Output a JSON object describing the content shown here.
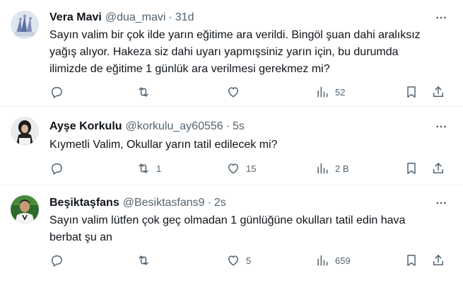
{
  "tweets": [
    {
      "name": "Vera Mavi",
      "handle": "@dua_mavi",
      "separator": "·",
      "time": "31d",
      "text_lines": [
        "Sayın valim bir çok ilde yarın eğitime ara verildi. Bingöl şuan dahi aralıksız",
        "yağış alıyor. Hakeza siz dahi uyarı yapmışsiniz yarın için, bu durumda",
        "ilimizde de eğitime 1 günlük ara verilmesi gerekmez mi?"
      ],
      "replies": "",
      "retweets": "",
      "likes": "",
      "views": "52",
      "avatar_colors": [
        "#dfe6ef",
        "#5a6fa3"
      ]
    },
    {
      "name": "Ayşe Korkulu",
      "handle": "@korkulu_ay60556",
      "separator": "·",
      "time": "5s",
      "text_lines": [
        "Kıymetli Valim, Okullar yarın tatil edilecek mi?"
      ],
      "replies": "",
      "retweets": "1",
      "likes": "15",
      "views": "2 B",
      "avatar_colors": [
        "#e9ecef",
        "#1a1a1a"
      ]
    },
    {
      "name": "Beşiktaşfans",
      "handle": "@Besiktasfans9",
      "separator": "·",
      "time": "2s",
      "text_lines": [
        "Sayın valim lütfen çok geç olmadan 1 günlüğüne okulları tatil edin hava",
        "berbat şu an"
      ],
      "replies": "",
      "retweets": "",
      "likes": "5",
      "views": "659",
      "avatar_colors": [
        "#2e6b2a",
        "#c99a78"
      ]
    }
  ],
  "icons": {
    "reply": "reply-icon",
    "retweet": "retweet-icon",
    "like": "like-icon",
    "views": "views-icon",
    "bookmark": "bookmark-icon",
    "share": "share-icon",
    "more": "more-icon"
  },
  "colors": {
    "text": "#0f1419",
    "secondary": "#536471",
    "divider": "#eff3f4",
    "background": "#ffffff"
  }
}
